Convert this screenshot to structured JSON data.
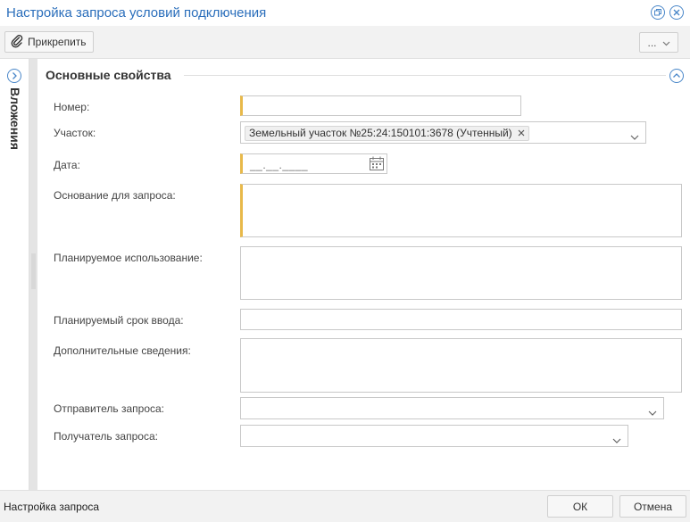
{
  "window": {
    "title": "Настройка запроса условий подключения"
  },
  "toolbar": {
    "attach_label": "Прикрепить",
    "more_label": "..."
  },
  "sidepanel": {
    "label": "Вложения"
  },
  "section": {
    "title": "Основные свойства"
  },
  "form": {
    "number": {
      "label": "Номер:",
      "value": ""
    },
    "plot": {
      "label": "Участок:",
      "tag": "Земельный участок №25:24:150101:3678 (Учтенный)"
    },
    "date": {
      "label": "Дата:",
      "mask": "__.__.____"
    },
    "basis": {
      "label": "Основание для запроса:",
      "value": ""
    },
    "planned_use": {
      "label": "Планируемое использование:",
      "value": ""
    },
    "planned_term": {
      "label": "Планируемый срок ввода:",
      "value": ""
    },
    "additional": {
      "label": "Дополнительные сведения:",
      "value": ""
    },
    "sender": {
      "label": "Отправитель запроса:",
      "value": ""
    },
    "recipient": {
      "label": "Получатель запроса:",
      "value": ""
    }
  },
  "footer": {
    "status": "Настройка запроса",
    "ok_label": "ОК",
    "cancel_label": "Отмена"
  },
  "colors": {
    "accent": "#2a6ebb",
    "required": "#e8b94a"
  }
}
